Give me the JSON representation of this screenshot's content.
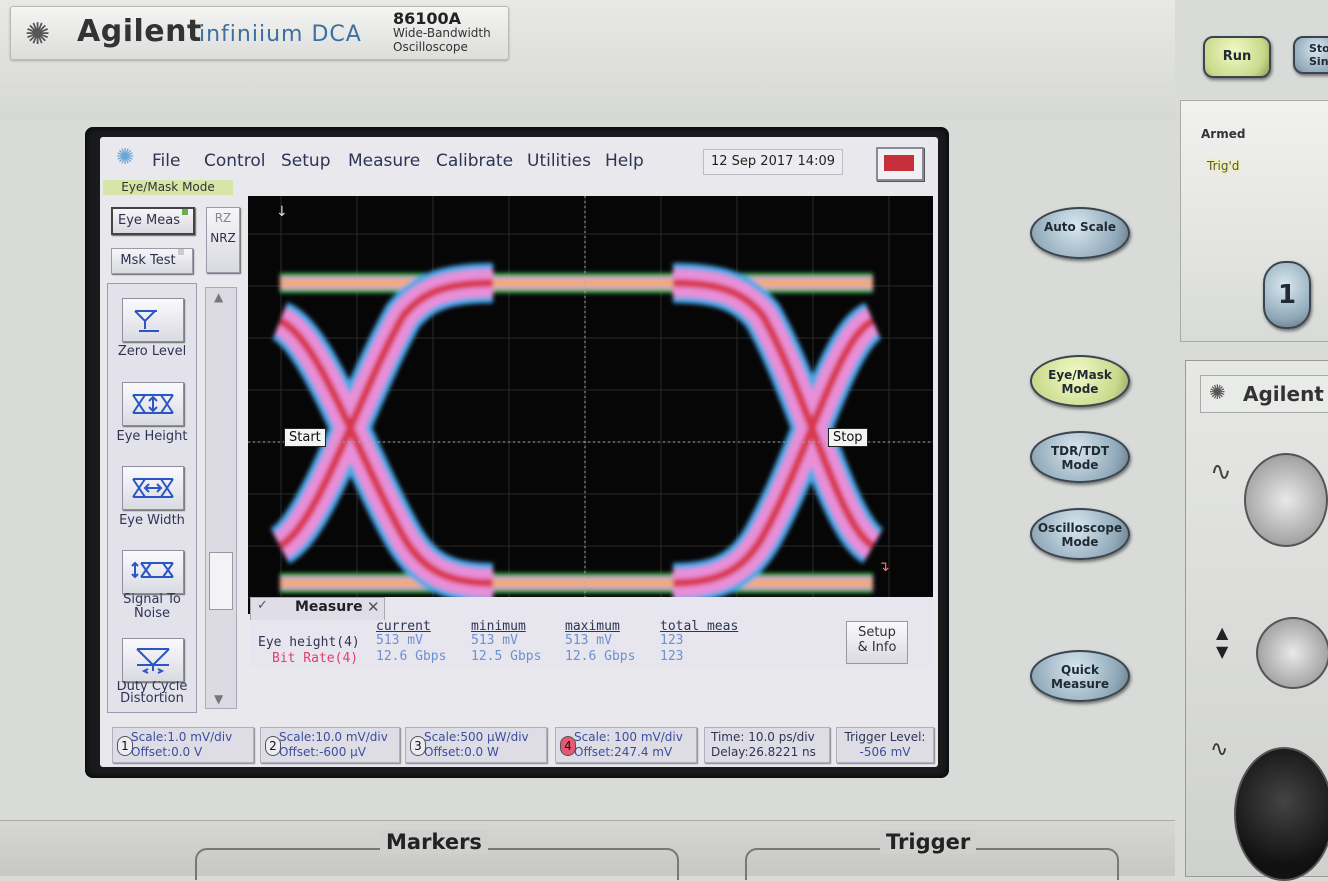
{
  "instrument": {
    "brand": "Agilent",
    "series": "infiniium DCA",
    "model": "86100A",
    "model_subtitle_1": "Wide-Bandwidth",
    "model_subtitle_2": "Oscilloscope"
  },
  "menu": {
    "items": [
      "File",
      "Control",
      "Setup",
      "Measure",
      "Calibrate",
      "Utilities",
      "Help"
    ],
    "datetime": "12 Sep 2017   14:09",
    "mode_label": "Eye/Mask Mode"
  },
  "left_panel": {
    "eye_meas": "Eye Meas",
    "mask_test": "Msk Test",
    "rz": "RZ",
    "nrz": "NRZ",
    "measurements": [
      "Zero Level",
      "Eye Height",
      "Eye Width",
      "Signal To Noise",
      "Duty Cycle Distortion"
    ]
  },
  "markers": {
    "start": "Start",
    "stop": "Stop"
  },
  "measure_panel": {
    "title": "Measure",
    "headers": [
      "current",
      "minimum",
      "maximum",
      "total meas"
    ],
    "rows": [
      {
        "label": "Eye height(4)",
        "values": [
          "513 mV",
          "513 mV",
          "513 mV",
          "123"
        ]
      },
      {
        "label": "Bit Rate(4)",
        "values": [
          "12.6 Gbps",
          "12.5 Gbps",
          "12.6 Gbps",
          "123"
        ]
      }
    ],
    "setup_label_1": "Setup",
    "setup_label_2": "& Info"
  },
  "status_bar": {
    "channels": [
      {
        "num": "1",
        "scale": "Scale:1.0 mV/div",
        "offset": "Offset:0.0 V"
      },
      {
        "num": "2",
        "scale": "Scale:10.0 mV/div",
        "offset": "Offset:-600 µV"
      },
      {
        "num": "3",
        "scale": "Scale:500 µW/div",
        "offset": "Offset:0.0 W"
      },
      {
        "num": "4",
        "scale": "Scale: 100 mV/div",
        "offset": "Offset:247.4 mV"
      }
    ],
    "time": "Time: 10.0 ps/div",
    "delay": "Delay:26.8221 ns",
    "trigger_level_label": "Trigger Level:",
    "trigger_level_value": "-506 mV"
  },
  "hardware": {
    "run": "Run",
    "stop_single": "Stop Single",
    "armed": "Armed",
    "trigd": "Trig'd",
    "auto_scale": "Auto Scale",
    "eye_mask_mode": "Eye/Mask Mode",
    "tdr_mode": "TDR/TDT Mode",
    "osc_mode": "Oscilloscope Mode",
    "quick_measure": "Quick Measure",
    "channel_num": "1",
    "module_brand": "Agilent",
    "markers_label": "Markers",
    "trigger_label": "Trigger"
  }
}
